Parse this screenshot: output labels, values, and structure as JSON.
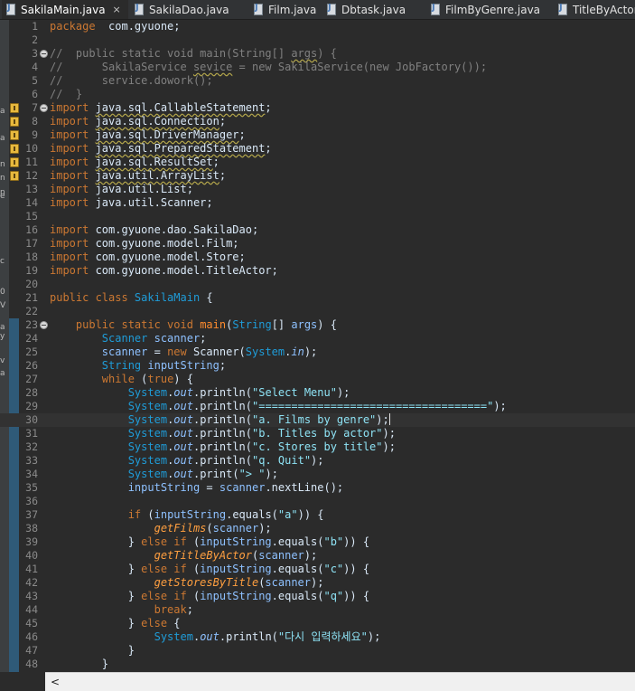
{
  "tabs": [
    {
      "label": "SakilaMain.java",
      "active": true,
      "close": "×"
    },
    {
      "label": "SakilaDao.java",
      "active": false
    },
    {
      "label": "Film.java",
      "active": false
    },
    {
      "label": "Dbtask.java",
      "active": false
    },
    {
      "label": "FilmByGenre.java",
      "active": false
    },
    {
      "label": "TitleByActor",
      "active": false
    }
  ],
  "left_strip_chars": [
    "a",
    "a",
    "n",
    "n",
    "n",
    "e",
    "c",
    "0",
    "V",
    "a",
    "y",
    "v",
    "a"
  ],
  "editor": {
    "current_line": 30,
    "lines": [
      {
        "n": "1",
        "tokens": [
          [
            "kw",
            "package"
          ],
          [
            "",
            "  com.gyuone;"
          ]
        ]
      },
      {
        "n": "2",
        "tokens": []
      },
      {
        "n": "3",
        "fold": true,
        "tokens": [
          [
            "cm",
            "//  public static void main(String[] "
          ],
          [
            "cm uw",
            "args"
          ],
          [
            "cm",
            ") {"
          ]
        ]
      },
      {
        "n": "4",
        "tokens": [
          [
            "cm",
            "//      SakilaService "
          ],
          [
            "cm uw",
            "sevice"
          ],
          [
            "cm",
            " = new SakilaService(new JobFactory());"
          ]
        ]
      },
      {
        "n": "5",
        "tokens": [
          [
            "cm",
            "//      service.dowork();"
          ]
        ]
      },
      {
        "n": "6",
        "tokens": [
          [
            "cm",
            "//  }"
          ]
        ]
      },
      {
        "n": "7",
        "fold": true,
        "warn": true,
        "tokens": [
          [
            "kw",
            "import "
          ],
          [
            "uw",
            "java.sql.CallableStatement"
          ],
          [
            "",
            ";"
          ]
        ]
      },
      {
        "n": "8",
        "warn": true,
        "tokens": [
          [
            "kw",
            "import "
          ],
          [
            "uw",
            "java.sql.Connection"
          ],
          [
            "",
            ";"
          ]
        ]
      },
      {
        "n": "9",
        "warn": true,
        "tokens": [
          [
            "kw",
            "import "
          ],
          [
            "uw",
            "java.sql.DriverManager"
          ],
          [
            "",
            ";"
          ]
        ]
      },
      {
        "n": "10",
        "warn": true,
        "tokens": [
          [
            "kw",
            "import "
          ],
          [
            "uw",
            "java.sql.PreparedStatement"
          ],
          [
            "",
            ";"
          ]
        ]
      },
      {
        "n": "11",
        "warn": true,
        "tokens": [
          [
            "kw",
            "import "
          ],
          [
            "uw",
            "java.sql.ResultSet"
          ],
          [
            "",
            ";"
          ]
        ]
      },
      {
        "n": "12",
        "warn": true,
        "tokens": [
          [
            "kw",
            "import "
          ],
          [
            "uw",
            "java.util.ArrayList"
          ],
          [
            "",
            ";"
          ]
        ]
      },
      {
        "n": "13",
        "tokens": [
          [
            "kw",
            "import "
          ],
          [
            "",
            "java.util.List;"
          ]
        ]
      },
      {
        "n": "14",
        "tokens": [
          [
            "kw",
            "import "
          ],
          [
            "",
            "java.util.Scanner;"
          ]
        ]
      },
      {
        "n": "15",
        "tokens": []
      },
      {
        "n": "16",
        "tokens": [
          [
            "kw",
            "import "
          ],
          [
            "",
            "com.gyuone.dao.SakilaDao;"
          ]
        ]
      },
      {
        "n": "17",
        "tokens": [
          [
            "kw",
            "import "
          ],
          [
            "",
            "com.gyuone.model.Film;"
          ]
        ]
      },
      {
        "n": "18",
        "tokens": [
          [
            "kw",
            "import "
          ],
          [
            "",
            "com.gyuone.model.Store;"
          ]
        ]
      },
      {
        "n": "19",
        "tokens": [
          [
            "kw",
            "import "
          ],
          [
            "",
            "com.gyuone.model.TitleActor;"
          ]
        ]
      },
      {
        "n": "20",
        "tokens": []
      },
      {
        "n": "21",
        "tokens": [
          [
            "kw",
            "public class "
          ],
          [
            "cls",
            "SakilaMain"
          ],
          [
            "",
            " {"
          ]
        ]
      },
      {
        "n": "22",
        "tokens": []
      },
      {
        "n": "23",
        "fold": true,
        "tokens": [
          [
            "",
            "    "
          ],
          [
            "kw",
            "public static void "
          ],
          [
            "fn",
            "main"
          ],
          [
            "",
            "("
          ],
          [
            "ty",
            "String"
          ],
          [
            "",
            "[] "
          ],
          [
            "vr",
            "args"
          ],
          [
            "",
            ") {"
          ]
        ]
      },
      {
        "n": "24",
        "tokens": [
          [
            "",
            "        "
          ],
          [
            "ty",
            "Scanner "
          ],
          [
            "vr",
            "scanner"
          ],
          [
            "",
            ";"
          ]
        ]
      },
      {
        "n": "25",
        "tokens": [
          [
            "",
            "        "
          ],
          [
            "vr",
            "scanner"
          ],
          [
            "",
            " = "
          ],
          [
            "kw",
            "new "
          ],
          [
            "",
            "Scanner("
          ],
          [
            "ty",
            "System"
          ],
          [
            "",
            "."
          ],
          [
            "fld",
            "in"
          ],
          [
            "",
            ");"
          ]
        ]
      },
      {
        "n": "26",
        "tokens": [
          [
            "",
            "        "
          ],
          [
            "ty",
            "String "
          ],
          [
            "vr",
            "inputString"
          ],
          [
            "",
            ";"
          ]
        ]
      },
      {
        "n": "27",
        "tokens": [
          [
            "",
            "        "
          ],
          [
            "kw",
            "while "
          ],
          [
            "",
            "("
          ],
          [
            "kw",
            "true"
          ],
          [
            "",
            ") {"
          ]
        ]
      },
      {
        "n": "28",
        "tokens": [
          [
            "",
            "            "
          ],
          [
            "ty",
            "System"
          ],
          [
            "",
            "."
          ],
          [
            "fld",
            "out"
          ],
          [
            "",
            ".println("
          ],
          [
            "str",
            "\"Select Menu\""
          ],
          [
            "",
            ");"
          ]
        ]
      },
      {
        "n": "29",
        "tokens": [
          [
            "",
            "            "
          ],
          [
            "ty",
            "System"
          ],
          [
            "",
            "."
          ],
          [
            "fld",
            "out"
          ],
          [
            "",
            ".println("
          ],
          [
            "str",
            "\"===================================\""
          ],
          [
            "",
            ");"
          ]
        ]
      },
      {
        "n": "30",
        "caret": true,
        "tokens": [
          [
            "",
            "            "
          ],
          [
            "ty",
            "System"
          ],
          [
            "",
            "."
          ],
          [
            "fld",
            "out"
          ],
          [
            "",
            ".println("
          ],
          [
            "str",
            "\"a. Films by genre\""
          ],
          [
            "",
            ");"
          ]
        ]
      },
      {
        "n": "31",
        "tokens": [
          [
            "",
            "            "
          ],
          [
            "ty",
            "System"
          ],
          [
            "",
            "."
          ],
          [
            "fld",
            "out"
          ],
          [
            "",
            ".println("
          ],
          [
            "str",
            "\"b. Titles by actor\""
          ],
          [
            "",
            ");"
          ]
        ]
      },
      {
        "n": "32",
        "tokens": [
          [
            "",
            "            "
          ],
          [
            "ty",
            "System"
          ],
          [
            "",
            "."
          ],
          [
            "fld",
            "out"
          ],
          [
            "",
            ".println("
          ],
          [
            "str",
            "\"c. Stores by title\""
          ],
          [
            "",
            ");"
          ]
        ]
      },
      {
        "n": "33",
        "tokens": [
          [
            "",
            "            "
          ],
          [
            "ty",
            "System"
          ],
          [
            "",
            "."
          ],
          [
            "fld",
            "out"
          ],
          [
            "",
            ".println("
          ],
          [
            "str",
            "\"q. Quit\""
          ],
          [
            "",
            ");"
          ]
        ]
      },
      {
        "n": "34",
        "tokens": [
          [
            "",
            "            "
          ],
          [
            "ty",
            "System"
          ],
          [
            "",
            "."
          ],
          [
            "fld",
            "out"
          ],
          [
            "",
            ".print("
          ],
          [
            "str",
            "\"> \""
          ],
          [
            "",
            ");"
          ]
        ]
      },
      {
        "n": "35",
        "tokens": [
          [
            "",
            "            "
          ],
          [
            "vr",
            "inputString"
          ],
          [
            "",
            " = "
          ],
          [
            "vr",
            "scanner"
          ],
          [
            "",
            ".nextLine();"
          ]
        ]
      },
      {
        "n": "36",
        "tokens": []
      },
      {
        "n": "37",
        "tokens": [
          [
            "",
            "            "
          ],
          [
            "kw",
            "if "
          ],
          [
            "",
            "("
          ],
          [
            "vr",
            "inputString"
          ],
          [
            "",
            ".equals("
          ],
          [
            "str",
            "\"a\""
          ],
          [
            "",
            ")) {"
          ]
        ]
      },
      {
        "n": "38",
        "tokens": [
          [
            "",
            "                "
          ],
          [
            "mth",
            "getFilms"
          ],
          [
            "",
            "("
          ],
          [
            "vr",
            "scanner"
          ],
          [
            "",
            ");"
          ]
        ]
      },
      {
        "n": "39",
        "tokens": [
          [
            "",
            "            } "
          ],
          [
            "kw",
            "else if "
          ],
          [
            "",
            "("
          ],
          [
            "vr",
            "inputString"
          ],
          [
            "",
            ".equals("
          ],
          [
            "str",
            "\"b\""
          ],
          [
            "",
            ")) {"
          ]
        ]
      },
      {
        "n": "40",
        "tokens": [
          [
            "",
            "                "
          ],
          [
            "mth",
            "getTitleByActor"
          ],
          [
            "",
            "("
          ],
          [
            "vr",
            "scanner"
          ],
          [
            "",
            ");"
          ]
        ]
      },
      {
        "n": "41",
        "tokens": [
          [
            "",
            "            } "
          ],
          [
            "kw",
            "else if "
          ],
          [
            "",
            "("
          ],
          [
            "vr",
            "inputString"
          ],
          [
            "",
            ".equals("
          ],
          [
            "str",
            "\"c\""
          ],
          [
            "",
            ")) {"
          ]
        ]
      },
      {
        "n": "42",
        "tokens": [
          [
            "",
            "                "
          ],
          [
            "mth",
            "getStoresByTitle"
          ],
          [
            "",
            "("
          ],
          [
            "vr",
            "scanner"
          ],
          [
            "",
            ");"
          ]
        ]
      },
      {
        "n": "43",
        "tokens": [
          [
            "",
            "            } "
          ],
          [
            "kw",
            "else if "
          ],
          [
            "",
            "("
          ],
          [
            "vr",
            "inputString"
          ],
          [
            "",
            ".equals("
          ],
          [
            "str",
            "\"q\""
          ],
          [
            "",
            ")) {"
          ]
        ]
      },
      {
        "n": "44",
        "tokens": [
          [
            "",
            "                "
          ],
          [
            "kw",
            "break"
          ],
          [
            "",
            ";"
          ]
        ]
      },
      {
        "n": "45",
        "tokens": [
          [
            "",
            "            } "
          ],
          [
            "kw",
            "else "
          ],
          [
            "",
            "{"
          ]
        ]
      },
      {
        "n": "46",
        "tokens": [
          [
            "",
            "                "
          ],
          [
            "ty",
            "System"
          ],
          [
            "",
            "."
          ],
          [
            "fld",
            "out"
          ],
          [
            "",
            ".println("
          ],
          [
            "str",
            "\"다시 입력하세요\""
          ],
          [
            "",
            ");"
          ]
        ]
      },
      {
        "n": "47",
        "tokens": [
          [
            "",
            "            }"
          ]
        ]
      },
      {
        "n": "48",
        "tokens": [
          [
            "",
            "        }"
          ]
        ]
      }
    ]
  },
  "hscroll": {
    "left_arrow": "<"
  }
}
